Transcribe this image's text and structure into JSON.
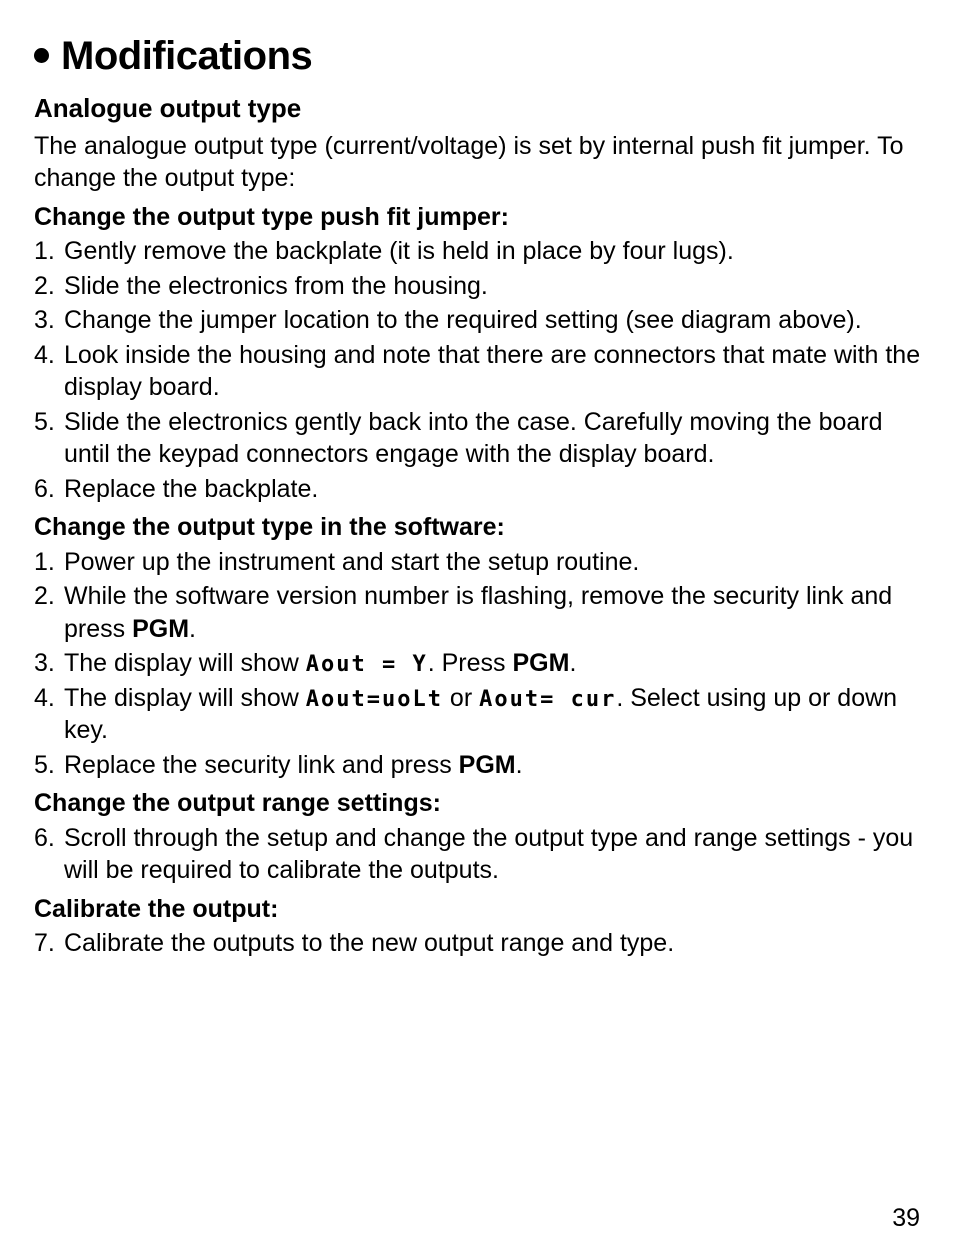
{
  "page_number": "39",
  "heading": "Modifications",
  "section": {
    "title": "Analogue output type",
    "intro": "The analogue output type (current/voltage) is set by internal push fit jumper. To change the output type:"
  },
  "groups": [
    {
      "title": "Change the output type push fit jumper:",
      "items": [
        {
          "n": "1.",
          "t": "Gently remove the backplate (it is held in place by four lugs)."
        },
        {
          "n": "2.",
          "t": "Slide the electronics from the housing."
        },
        {
          "n": "3.",
          "t": "Change the jumper location to the required setting (see diagram above)."
        },
        {
          "n": "4.",
          "t": "Look inside the housing and note that there are connectors that mate with the display board."
        },
        {
          "n": "5.",
          "t": "Slide the electronics gently back into the case. Carefully moving the board until the keypad connectors engage with the display board."
        },
        {
          "n": "6.",
          "t": "Replace the backplate."
        }
      ]
    },
    {
      "title": "Change the output type in the software:",
      "items": [
        {
          "n": "1.",
          "t": "Power up the instrument and start the setup routine."
        }
      ]
    }
  ],
  "sw_item2": {
    "n": "2.",
    "pre": "While the software version number is flashing, remove the security link and press ",
    "pgm": "PGM",
    "post": "."
  },
  "sw_item3": {
    "n": "3.",
    "pre": "The display will show ",
    "seg1": "Aout  =  Y",
    "mid": ".  Press ",
    "pgm": "PGM",
    "post": "."
  },
  "sw_item4": {
    "n": "4.",
    "pre": "The display will show ",
    "seg1": "Aout=uoLt",
    "mid1": " or ",
    "seg2": "Aout=  cur",
    "post": ". Select using up or down key."
  },
  "sw_item5": {
    "n": "5.",
    "pre": "Replace the security link and press ",
    "pgm": "PGM",
    "post": "."
  },
  "group_range": {
    "title": "Change the output range settings:",
    "item": {
      "n": "6.",
      "t": "Scroll through the setup and change the output type and range settings - you will be required to calibrate the outputs."
    }
  },
  "group_cal": {
    "title": "Calibrate the output:",
    "item": {
      "n": "7.",
      "t": "Calibrate the outputs to the new output range and type."
    }
  }
}
